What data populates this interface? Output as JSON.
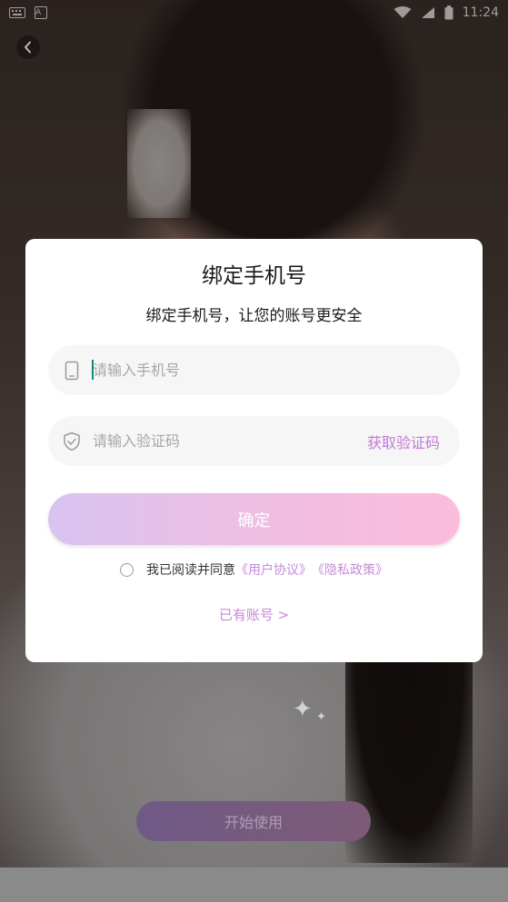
{
  "status_bar": {
    "time": "11:24"
  },
  "background": {
    "start_button_label": "开始使用"
  },
  "dialog": {
    "title": "绑定手机号",
    "subtitle": "绑定手机号，让您的账号更安全",
    "phone_field": {
      "placeholder": "请输入手机号",
      "value": "",
      "icon": "phone-icon"
    },
    "code_field": {
      "placeholder": "请输入验证码",
      "value": "",
      "icon": "shield-check-icon",
      "get_code_label": "获取验证码"
    },
    "confirm_label": "确定",
    "agreement": {
      "checked": false,
      "prefix": "我已阅读并同意",
      "user_agreement": "《用户协议》",
      "privacy_policy": "《隐私政策》"
    },
    "have_account_label": "已有账号 >"
  },
  "colors": {
    "accent": "#c48ad8",
    "button_gradient_start": "#d9c3f0",
    "button_gradient_end": "#fcbcdc",
    "caret": "#0d8a7c"
  }
}
